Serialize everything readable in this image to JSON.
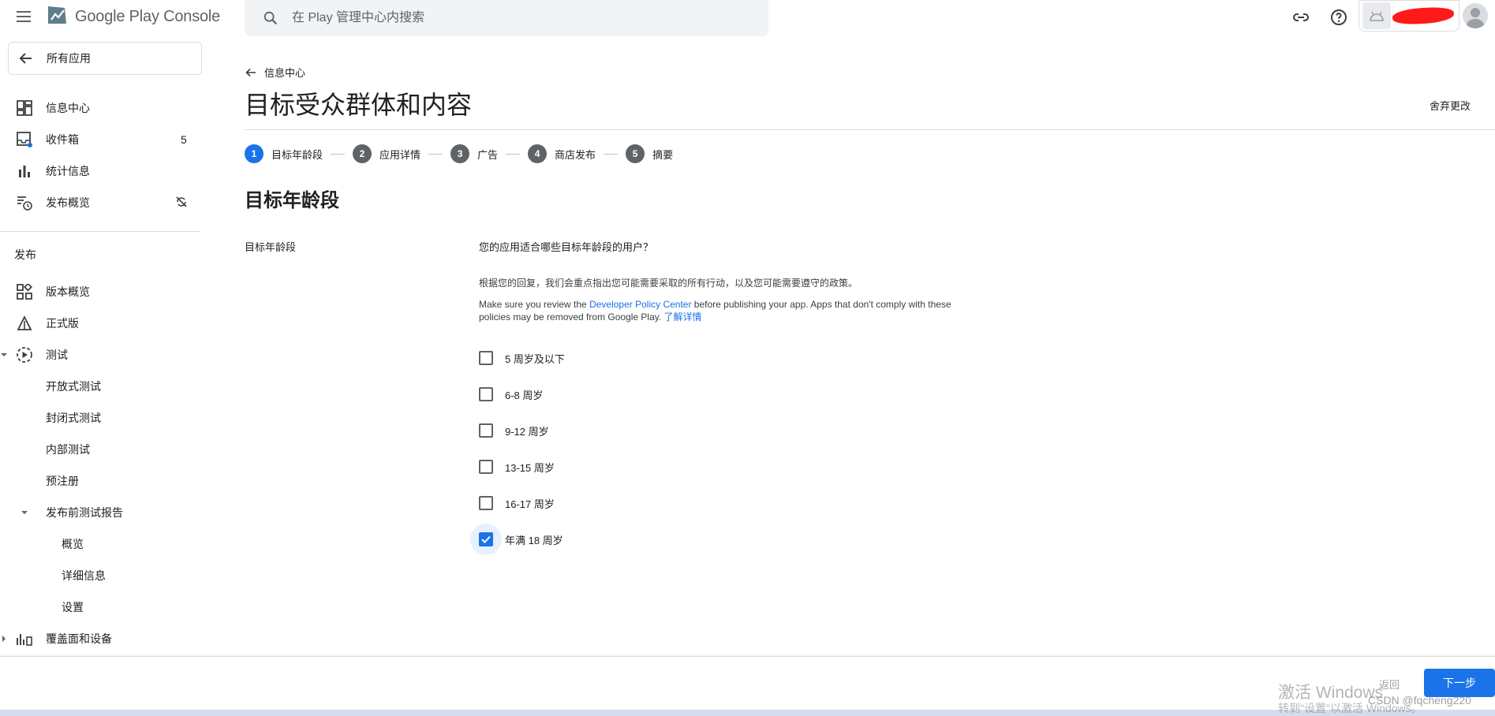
{
  "header": {
    "brand": "Google Play Console",
    "search_placeholder": "在 Play 管理中心内搜索"
  },
  "sidebar": {
    "all_apps": "所有应用",
    "top_items": [
      {
        "label": "信息中心"
      },
      {
        "label": "收件箱",
        "count": "5"
      },
      {
        "label": "统计信息"
      },
      {
        "label": "发布概览"
      }
    ],
    "section_title": "发布",
    "release_items": [
      {
        "label": "版本概览"
      },
      {
        "label": "正式版"
      },
      {
        "label": "测试"
      },
      {
        "label": "开放式测试"
      },
      {
        "label": "封闭式测试"
      },
      {
        "label": "内部测试"
      },
      {
        "label": "预注册"
      },
      {
        "label": "发布前测试报告"
      },
      {
        "label": "概览"
      },
      {
        "label": "详细信息"
      },
      {
        "label": "设置"
      },
      {
        "label": "覆盖面和设备"
      }
    ]
  },
  "main": {
    "back_link": "信息中心",
    "title": "目标受众群体和内容",
    "discard": "舍弃更改",
    "steps": [
      {
        "num": "1",
        "label": "目标年龄段"
      },
      {
        "num": "2",
        "label": "应用详情"
      },
      {
        "num": "3",
        "label": "广告"
      },
      {
        "num": "4",
        "label": "商店发布"
      },
      {
        "num": "5",
        "label": "摘要"
      }
    ],
    "section_heading": "目标年龄段",
    "field_label": "目标年龄段",
    "question": "您的应用适合哪些目标年龄段的用户？",
    "desc1": "根据您的回复，我们会重点指出您可能需要采取的所有行动，以及您可能需要遵守的政策。",
    "desc2_pre": "Make sure you review the ",
    "desc2_link": "Developer Policy Center",
    "desc2_post": " before publishing your app. Apps that don't comply with these policies may be removed from Google Play. ",
    "learn_more": "了解详情",
    "options": [
      {
        "label": "5 周岁及以下",
        "checked": false
      },
      {
        "label": "6-8 周岁",
        "checked": false
      },
      {
        "label": "9-12 周岁",
        "checked": false
      },
      {
        "label": "13-15 周岁",
        "checked": false
      },
      {
        "label": "16-17 周岁",
        "checked": false
      },
      {
        "label": "年满 18 周岁",
        "checked": true
      }
    ]
  },
  "footer": {
    "back": "返回",
    "next": "下一步",
    "watermark_title": "激活 Windows",
    "watermark_sub": "转到\"设置\"以激活 Windows。",
    "csdn": "CSDN @fqcheng220"
  },
  "colors": {
    "accent": "#1a73e8",
    "step_inactive": "#5f6368",
    "border": "#dadce0"
  }
}
